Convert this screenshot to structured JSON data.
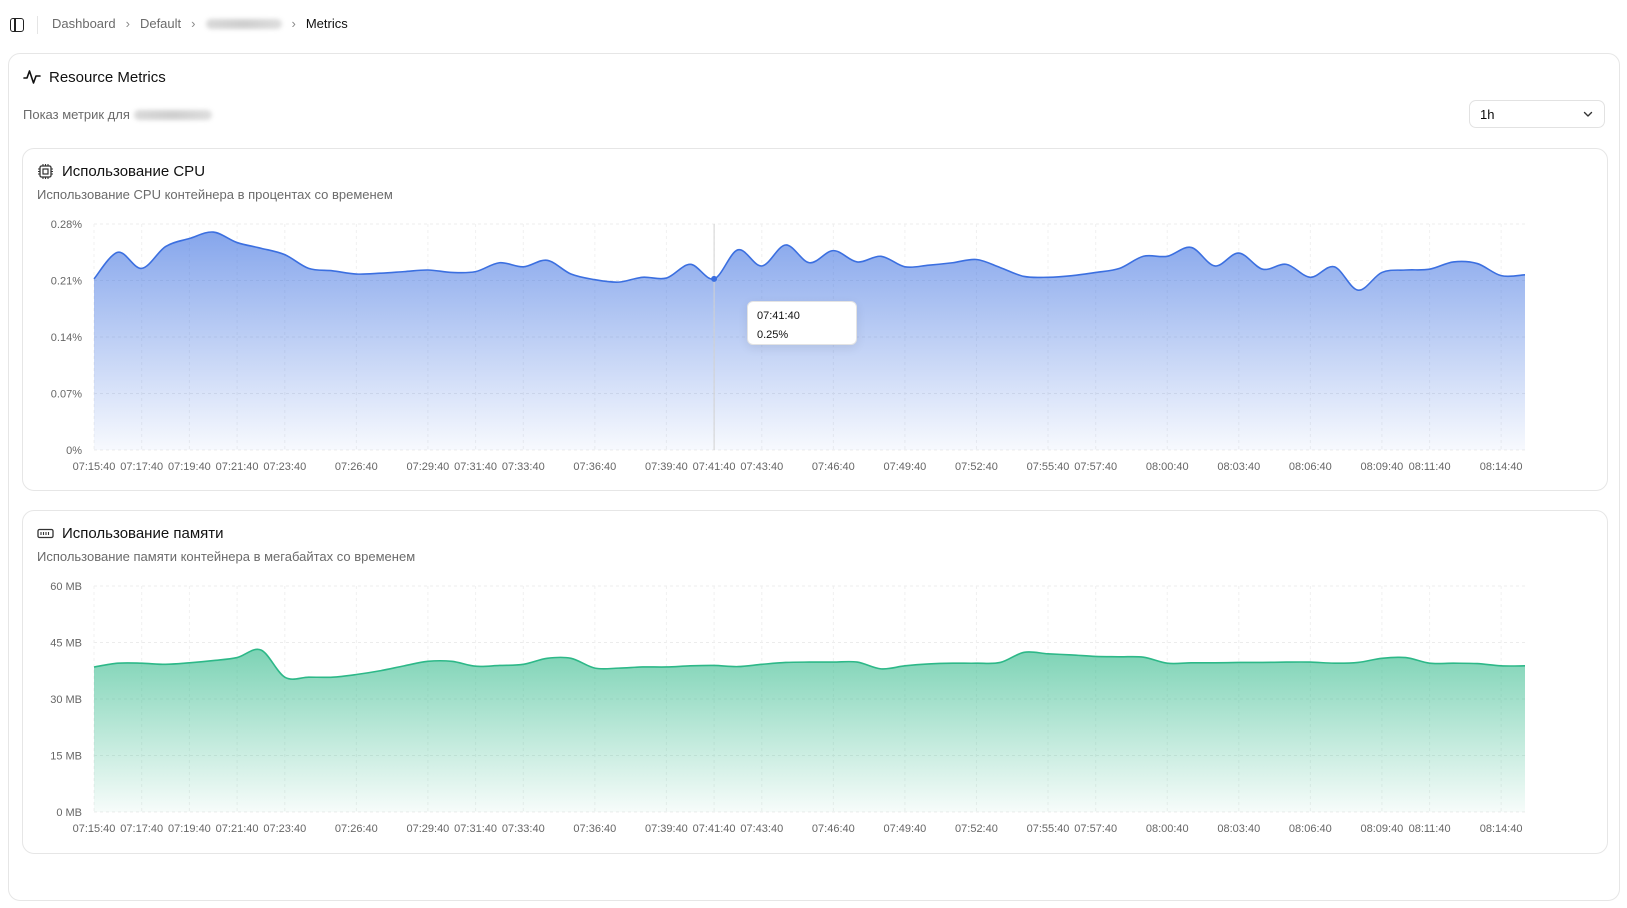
{
  "breadcrumb": {
    "items": [
      "Dashboard",
      "Default"
    ],
    "current": "Metrics"
  },
  "header": {
    "title": "Resource Metrics",
    "subtitle": "Показ метрик для",
    "range_select": "1h"
  },
  "cpu_card": {
    "title": "Использование CPU",
    "description": "Использование CPU контейнера в процентах со временем",
    "color": "#3b6fe0",
    "tooltip": {
      "time": "07:41:40",
      "value": "0.25%"
    }
  },
  "memory_card": {
    "title": "Использование памяти",
    "description": "Использование памяти контейнера в мегабайтах со временем",
    "color": "#2db888"
  },
  "chart_data": [
    {
      "type": "area",
      "title": "Использование CPU",
      "ylim": [
        0,
        0.28
      ],
      "y_ticks": [
        "0%",
        "0.07%",
        "0.14%",
        "0.21%",
        "0.28%"
      ],
      "x_ticks": [
        "07:15:40",
        "07:17:40",
        "07:19:40",
        "07:21:40",
        "07:23:40",
        "07:26:40",
        "07:29:40",
        "07:31:40",
        "07:33:40",
        "07:36:40",
        "07:39:40",
        "07:41:40",
        "07:43:40",
        "07:46:40",
        "07:49:40",
        "07:52:40",
        "07:55:40",
        "07:57:40",
        "08:00:40",
        "08:03:40",
        "08:06:40",
        "08:09:40",
        "08:11:40",
        "08:14:40"
      ],
      "x_range": [
        "07:15:40",
        "08:15:40"
      ],
      "grid": true,
      "series": [
        {
          "x": [
            "07:15:40",
            "07:16:40",
            "07:17:40",
            "07:18:40",
            "07:19:40",
            "07:20:40",
            "07:21:40",
            "07:22:40",
            "07:23:40",
            "07:24:40",
            "07:25:40",
            "07:26:40",
            "07:27:40",
            "07:28:40",
            "07:29:40",
            "07:30:40",
            "07:31:40",
            "07:32:40",
            "07:33:40",
            "07:34:40",
            "07:35:40",
            "07:36:40",
            "07:37:40",
            "07:38:40",
            "07:39:40",
            "07:40:40",
            "07:41:40",
            "07:42:40",
            "07:43:40",
            "07:44:40",
            "07:45:40",
            "07:46:40",
            "07:47:40",
            "07:48:40",
            "07:49:40",
            "07:50:40",
            "07:51:40",
            "07:52:40",
            "07:53:40",
            "07:54:40",
            "07:55:40",
            "07:56:40",
            "07:57:40",
            "07:58:40",
            "07:59:40",
            "08:00:40",
            "08:01:40",
            "08:02:40",
            "08:03:40",
            "08:04:40",
            "08:05:40",
            "08:06:40",
            "08:07:40",
            "08:08:40",
            "08:09:40",
            "08:10:40",
            "08:11:40",
            "08:12:40",
            "08:13:40",
            "08:14:40",
            "08:15:40"
          ],
          "values": [
            0.212,
            0.245,
            0.225,
            0.252,
            0.262,
            0.27,
            0.257,
            0.25,
            0.242,
            0.225,
            0.222,
            0.218,
            0.219,
            0.221,
            0.223,
            0.22,
            0.221,
            0.232,
            0.227,
            0.235,
            0.218,
            0.211,
            0.208,
            0.214,
            0.213,
            0.23,
            0.212,
            0.248,
            0.228,
            0.254,
            0.232,
            0.247,
            0.233,
            0.24,
            0.227,
            0.229,
            0.232,
            0.236,
            0.226,
            0.215,
            0.214,
            0.216,
            0.22,
            0.225,
            0.24,
            0.24,
            0.251,
            0.228,
            0.244,
            0.224,
            0.23,
            0.214,
            0.227,
            0.198,
            0.22,
            0.223,
            0.224,
            0.233,
            0.231,
            0.216,
            0.217
          ]
        }
      ]
    },
    {
      "type": "area",
      "title": "Использование памяти",
      "ylim": [
        0,
        60
      ],
      "y_ticks": [
        "0 MB",
        "15 MB",
        "30 MB",
        "45 MB",
        "60 MB"
      ],
      "x_ticks": [
        "07:15:40",
        "07:17:40",
        "07:19:40",
        "07:21:40",
        "07:23:40",
        "07:26:40",
        "07:29:40",
        "07:31:40",
        "07:33:40",
        "07:36:40",
        "07:39:40",
        "07:41:40",
        "07:43:40",
        "07:46:40",
        "07:49:40",
        "07:52:40",
        "07:55:40",
        "07:57:40",
        "08:00:40",
        "08:03:40",
        "08:06:40",
        "08:09:40",
        "08:11:40",
        "08:14:40"
      ],
      "x_range": [
        "07:15:40",
        "08:15:40"
      ],
      "grid": true,
      "series": [
        {
          "x": [
            "07:15:40",
            "07:16:40",
            "07:17:40",
            "07:18:40",
            "07:19:40",
            "07:20:40",
            "07:21:40",
            "07:22:40",
            "07:23:40",
            "07:24:40",
            "07:25:40",
            "07:26:40",
            "07:27:40",
            "07:28:40",
            "07:29:40",
            "07:30:40",
            "07:31:40",
            "07:32:40",
            "07:33:40",
            "07:34:40",
            "07:35:40",
            "07:36:40",
            "07:37:40",
            "07:38:40",
            "07:39:40",
            "07:40:40",
            "07:41:40",
            "07:42:40",
            "07:43:40",
            "07:44:40",
            "07:45:40",
            "07:46:40",
            "07:47:40",
            "07:48:40",
            "07:49:40",
            "07:50:40",
            "07:51:40",
            "07:52:40",
            "07:53:40",
            "07:54:40",
            "07:55:40",
            "07:56:40",
            "07:57:40",
            "07:58:40",
            "07:59:40",
            "08:00:40",
            "08:01:40",
            "08:02:40",
            "08:03:40",
            "08:04:40",
            "08:05:40",
            "08:06:40",
            "08:07:40",
            "08:08:40",
            "08:09:40",
            "08:10:40",
            "08:11:40",
            "08:12:40",
            "08:13:40",
            "08:14:40",
            "08:15:40"
          ],
          "values": [
            38.5,
            39.5,
            39.5,
            39.2,
            39.6,
            40.2,
            41.0,
            43.0,
            35.8,
            35.8,
            35.8,
            36.5,
            37.5,
            38.8,
            40.0,
            40.0,
            38.7,
            38.9,
            39.2,
            40.8,
            40.8,
            38.2,
            38.2,
            38.5,
            38.5,
            38.8,
            38.9,
            38.6,
            39.2,
            39.7,
            39.8,
            39.8,
            39.8,
            38.0,
            38.8,
            39.3,
            39.5,
            39.5,
            39.7,
            42.4,
            42.0,
            41.7,
            41.3,
            41.2,
            41.1,
            39.5,
            39.6,
            39.6,
            39.7,
            39.7,
            39.8,
            39.8,
            39.5,
            39.7,
            40.8,
            41.0,
            39.5,
            39.5,
            39.4,
            38.8,
            38.8
          ]
        }
      ]
    }
  ]
}
